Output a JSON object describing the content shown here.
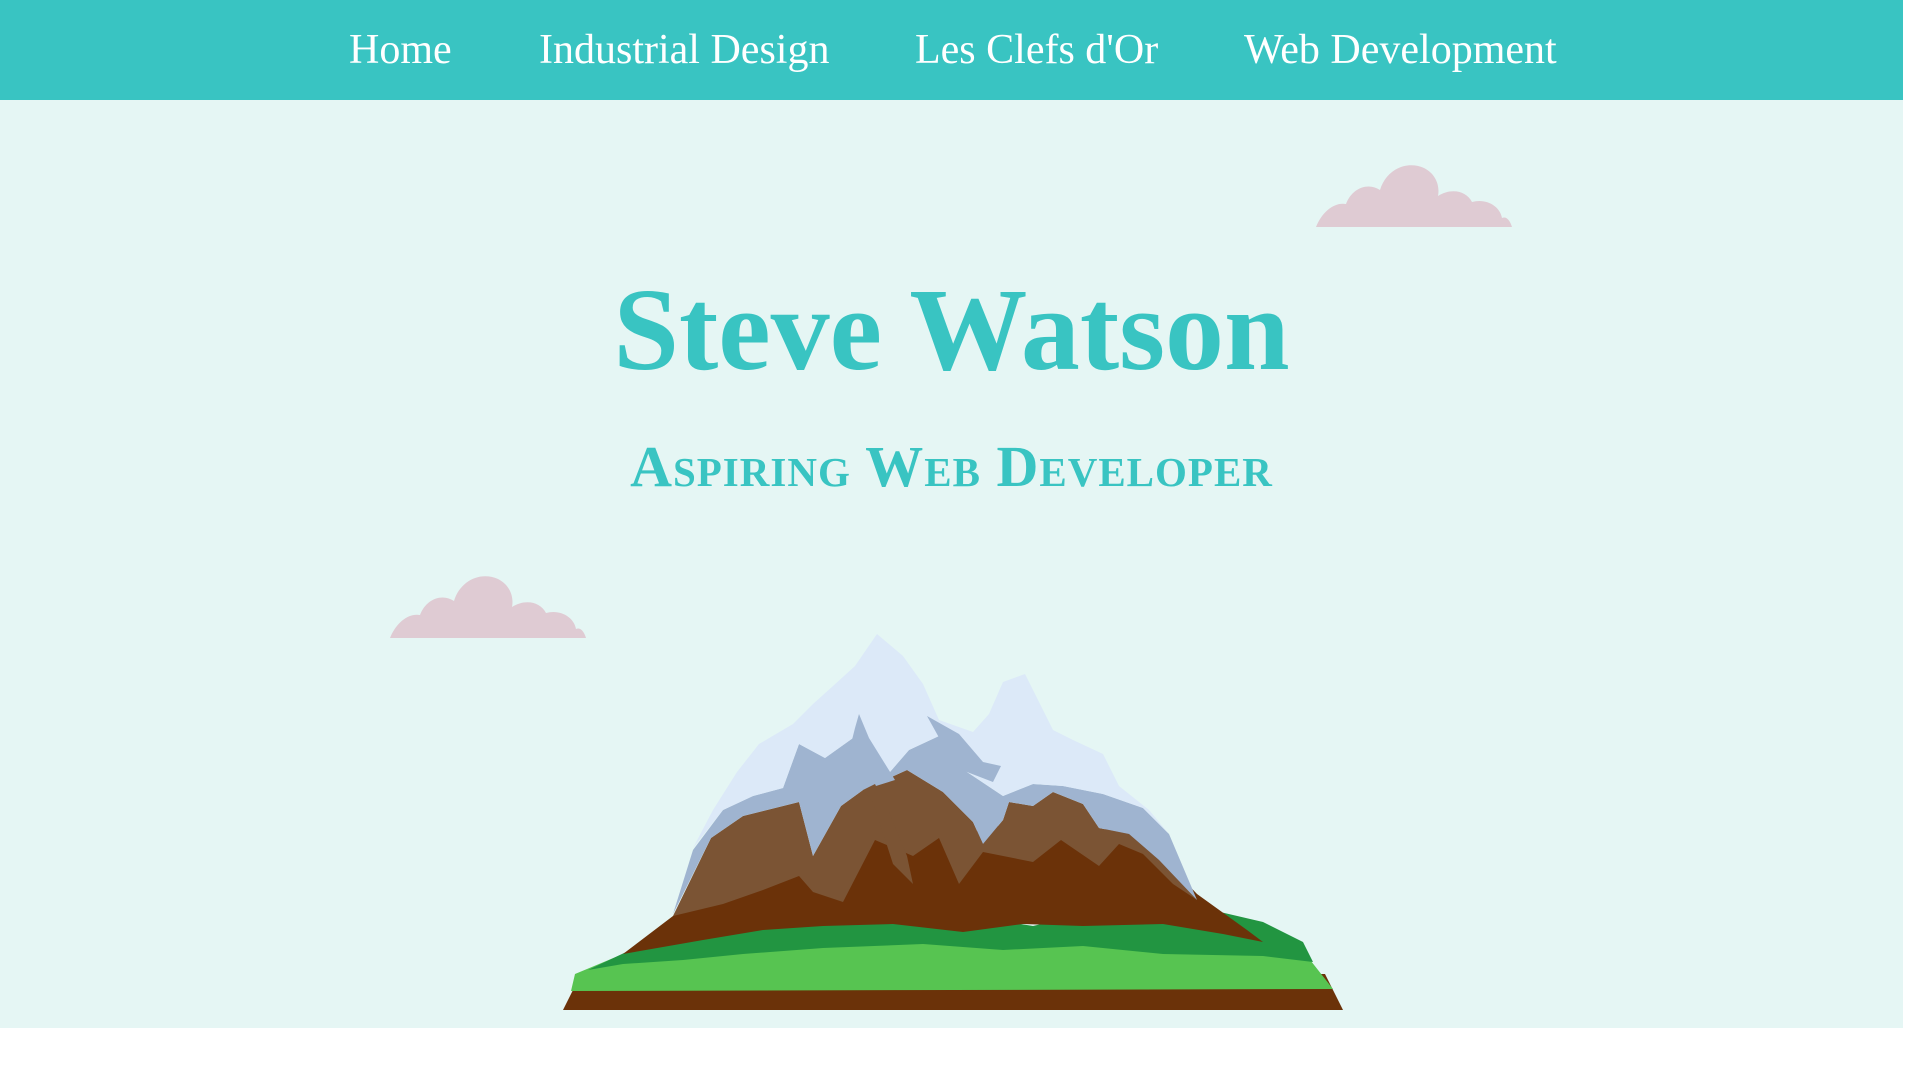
{
  "nav": {
    "items": [
      {
        "label": "Home"
      },
      {
        "label": "Industrial Design"
      },
      {
        "label": "Les Clefs d'Or"
      },
      {
        "label": "Web Development"
      }
    ]
  },
  "hero": {
    "title": "Steve Watson",
    "subtitle": "Aspiring Web Developer"
  },
  "colors": {
    "accent": "#39c4c2",
    "hero_background": "#e5f6f4",
    "cloud": "#dfcbd3"
  },
  "icons": {
    "cloud": "cloud-icon",
    "mountain": "mountain-illustration"
  }
}
